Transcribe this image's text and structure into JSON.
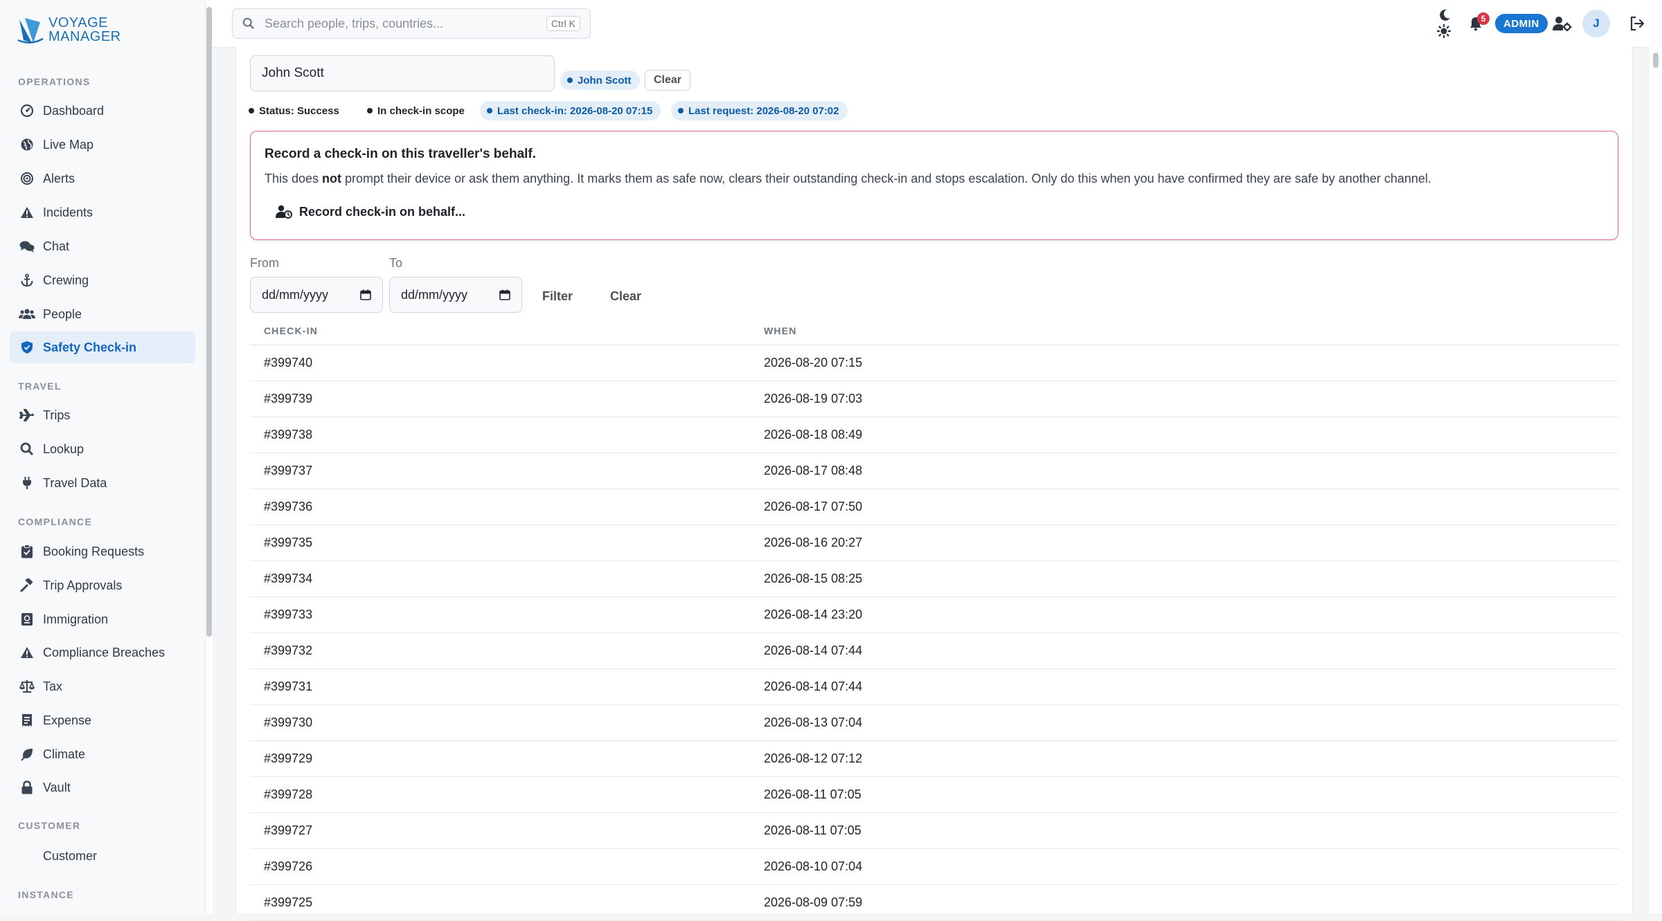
{
  "app": {
    "logo_line1": "VOYAGE",
    "logo_line2": "MANAGER"
  },
  "sidebar": {
    "sections": [
      {
        "title": "OPERATIONS",
        "items": [
          {
            "label": "Dashboard",
            "icon": "dashboard-icon"
          },
          {
            "label": "Live Map",
            "icon": "globe-icon"
          },
          {
            "label": "Alerts",
            "icon": "target-icon"
          },
          {
            "label": "Incidents",
            "icon": "warning-icon"
          },
          {
            "label": "Chat",
            "icon": "chat-icon"
          },
          {
            "label": "Crewing",
            "icon": "anchor-icon"
          },
          {
            "label": "People",
            "icon": "people-icon"
          },
          {
            "label": "Safety Check-in",
            "icon": "shield-icon",
            "active": true
          }
        ]
      },
      {
        "title": "TRAVEL",
        "items": [
          {
            "label": "Trips",
            "icon": "plane-icon"
          },
          {
            "label": "Lookup",
            "icon": "search-icon"
          },
          {
            "label": "Travel Data",
            "icon": "plug-icon"
          }
        ]
      },
      {
        "title": "COMPLIANCE",
        "items": [
          {
            "label": "Booking Requests",
            "icon": "clipboard-icon"
          },
          {
            "label": "Trip Approvals",
            "icon": "gavel-icon"
          },
          {
            "label": "Immigration",
            "icon": "passport-icon"
          },
          {
            "label": "Compliance Breaches",
            "icon": "warning-icon"
          },
          {
            "label": "Tax",
            "icon": "scale-icon"
          },
          {
            "label": "Expense",
            "icon": "receipt-icon"
          },
          {
            "label": "Climate",
            "icon": "leaf-icon"
          },
          {
            "label": "Vault",
            "icon": "lock-icon"
          }
        ]
      },
      {
        "title": "CUSTOMER",
        "items": [
          {
            "label": "Customer",
            "icon": ""
          }
        ]
      },
      {
        "title": "INSTANCE",
        "items": []
      }
    ]
  },
  "topbar": {
    "search_placeholder": "Search people, trips, countries...",
    "search_shortcut": "Ctrl K",
    "notification_count": "5",
    "role_badge": "ADMIN",
    "avatar_initial": "J"
  },
  "filter": {
    "person_value": "John Scott",
    "selected_chip": "John Scott",
    "clear_label": "Clear"
  },
  "status_chips": {
    "status": "Status: Success",
    "scope": "In check-in scope",
    "last_checkin": "Last check-in: 2026-08-20 07:15",
    "last_request": "Last request: 2026-08-20 07:02"
  },
  "warning": {
    "title": "Record a check-in on this traveller's behalf.",
    "text_before": "This does ",
    "text_bold": "not",
    "text_after": " prompt their device or ask them anything. It marks them as safe now, clears their outstanding check-in and stops escalation. Only do this when you have confirmed they are safe by another channel.",
    "button_label": "Record check-in on behalf..."
  },
  "date_filter": {
    "from_label": "From",
    "to_label": "To",
    "from_placeholder": "dd/mm/yyyy",
    "to_placeholder": "dd/mm/yyyy",
    "filter_label": "Filter",
    "clear_label": "Clear"
  },
  "table": {
    "headers": [
      "CHECK-IN",
      "WHEN"
    ],
    "rows": [
      [
        "#399740",
        "2026-08-20 07:15"
      ],
      [
        "#399739",
        "2026-08-19 07:03"
      ],
      [
        "#399738",
        "2026-08-18 08:49"
      ],
      [
        "#399737",
        "2026-08-17 08:48"
      ],
      [
        "#399736",
        "2026-08-17 07:50"
      ],
      [
        "#399735",
        "2026-08-16 20:27"
      ],
      [
        "#399734",
        "2026-08-15 08:25"
      ],
      [
        "#399733",
        "2026-08-14 23:20"
      ],
      [
        "#399732",
        "2026-08-14 07:44"
      ],
      [
        "#399731",
        "2026-08-14 07:44"
      ],
      [
        "#399730",
        "2026-08-13 07:04"
      ],
      [
        "#399729",
        "2026-08-12 07:12"
      ],
      [
        "#399728",
        "2026-08-11 07:05"
      ],
      [
        "#399727",
        "2026-08-11 07:05"
      ],
      [
        "#399726",
        "2026-08-10 07:04"
      ],
      [
        "#399725",
        "2026-08-09 07:59"
      ]
    ]
  },
  "colors": {
    "accent": "#1976d2",
    "active_bg": "#e4eef9",
    "danger": "#dc3545",
    "warning_border": "#e06b7a"
  }
}
